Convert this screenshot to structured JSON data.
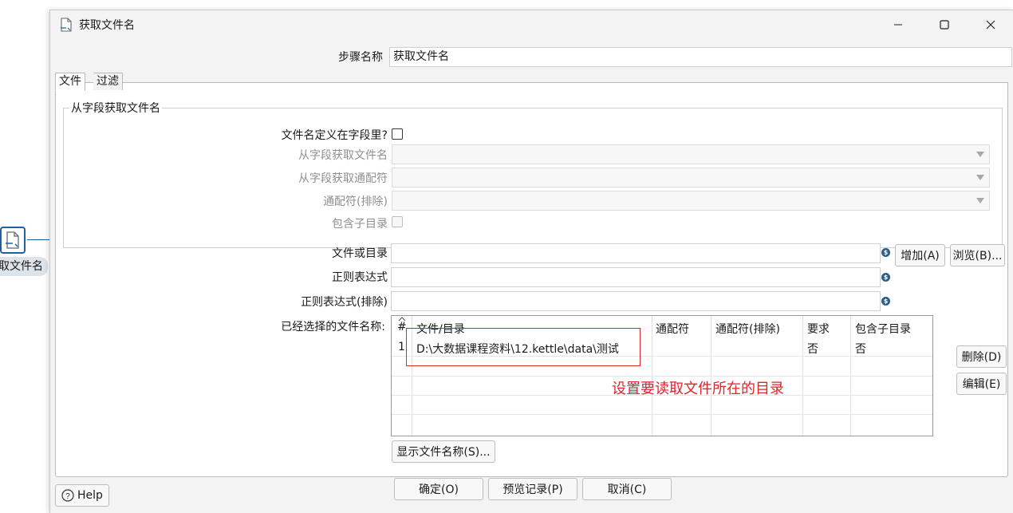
{
  "canvas": {
    "step_label": "取文件名"
  },
  "window": {
    "title": "获取文件名",
    "minimize_icon": "minimize-icon",
    "maximize_icon": "maximize-icon",
    "close_icon": "close-icon"
  },
  "step_name": {
    "label": "步骤名称",
    "value": "获取文件名"
  },
  "tabs": [
    {
      "label": "文件",
      "active": true
    },
    {
      "label": "过滤",
      "active": false
    }
  ],
  "from_field_group": {
    "title": "从字段获取文件名",
    "filename_in_field_label": "文件名定义在字段里?",
    "filename_from_field_label": "从字段获取文件名",
    "wildcard_from_field_label": "从字段获取通配符",
    "wildcard_exclude_label": "通配符(排除)",
    "include_subfolders_label": "包含子目录"
  },
  "file_or_dir": {
    "label": "文件或目录",
    "value": ""
  },
  "regex": {
    "label": "正则表达式",
    "value": ""
  },
  "regex_exclude": {
    "label": "正则表达式(排除)",
    "value": ""
  },
  "buttons": {
    "add": "增加(A)",
    "browse": "浏览(B)...",
    "delete": "删除(D)",
    "edit": "编辑(E)",
    "show_filenames": "显示文件名称(S)...",
    "ok": "确定(O)",
    "preview": "预览记录(P)",
    "cancel": "取消(C)",
    "help": "Help"
  },
  "selected_files": {
    "label": "已经选择的文件名称:",
    "columns": [
      "#",
      "文件/目录",
      "通配符",
      "通配符(排除)",
      "要求",
      "包含子目录"
    ],
    "rows": [
      {
        "index": "1",
        "path": "D:\\大数据课程资料\\12.kettle\\data\\测试",
        "wildcard": "",
        "exclude": "",
        "required": "否",
        "subfolders": "否"
      }
    ]
  },
  "annotation": {
    "text": "设置要读取文件所在的目录",
    "color": "#e0242b"
  }
}
